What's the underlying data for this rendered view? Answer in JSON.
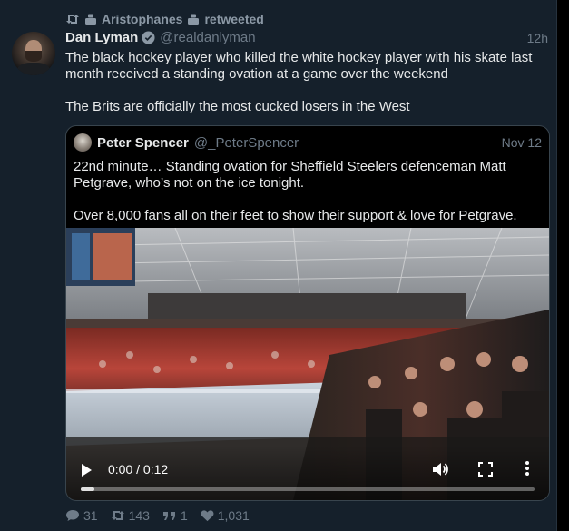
{
  "retweet": {
    "icon": "retweet-icon",
    "user_icon": "person-icon",
    "name": "Aristophanes",
    "label": "retweeted"
  },
  "tweet": {
    "author_name": "Dan Lyman",
    "verified_icon": "verified-badge-icon",
    "handle": "@realdanlyman",
    "time": "12h",
    "text": "The black hockey player who killed the white hockey player with his skate last month received a standing ovation at a game over the weekend\n\nThe Brits are officially the most cucked losers in the West"
  },
  "quote": {
    "author_name": "Peter Spencer",
    "handle": "@_PeterSpencer",
    "time": "Nov 12",
    "text": "22nd minute… Standing ovation for Sheffield Steelers defenceman Matt Petgrave, who’s not on the ice tonight.\n\nOver 8,000 fans all on their feet to show their support & love for Petgrave."
  },
  "video": {
    "time_display": "0:00 / 0:12",
    "play_icon": "play-icon",
    "volume_icon": "volume-icon",
    "fullscreen_icon": "fullscreen-icon",
    "more_icon": "more-vertical-icon",
    "buffered_fraction": 0.03
  },
  "stats": {
    "replies": "31",
    "retweets": "143",
    "quotes": "1",
    "likes": "1,031"
  },
  "colors": {
    "background": "#15202b",
    "secondary_text": "#8b98a5",
    "verified_blue": "#1d9bf0"
  }
}
